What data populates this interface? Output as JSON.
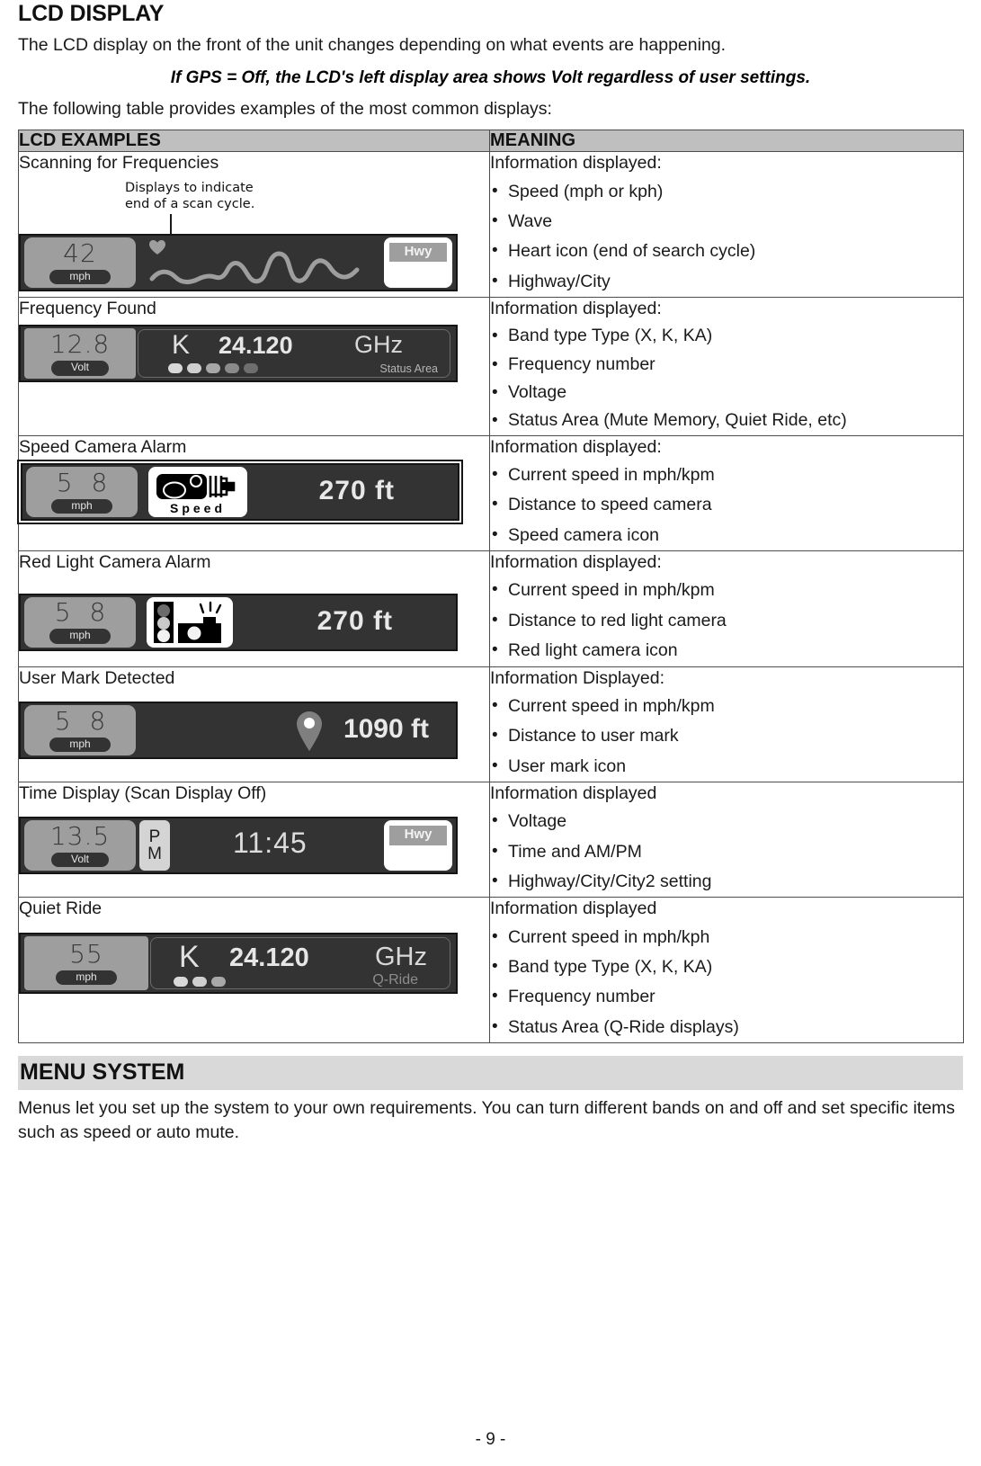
{
  "page": {
    "section_heading": "LCD DISPLAY",
    "intro_paragraph": "The LCD display on the front of the unit changes depending on what events are happening.",
    "note": "If GPS = Off, the LCD's left display area shows Volt regardless of user settings.",
    "lead_in": "The following table provides examples of the most common displays:",
    "footer": "- 9 -"
  },
  "table": {
    "headers": [
      "LCD EXAMPLES",
      "MEANING"
    ],
    "rows": [
      {
        "label": "Scanning for Frequencies",
        "callout": "Displays to indicate\nend of a scan cycle.",
        "callout_line1": "Displays to indicate",
        "callout_line2": "end of a scan cycle.",
        "lcd": {
          "left_value": "42",
          "left_unit": "mph",
          "hwy_label": "Hwy"
        },
        "meaning_head": "Information displayed:",
        "meaning_items": [
          "Speed (mph or kph)",
          "Wave",
          "Heart icon (end of search cycle)",
          "Highway/City"
        ]
      },
      {
        "label": "Frequency Found",
        "lcd": {
          "left_value": "12.8",
          "left_unit": "Volt",
          "band": "K",
          "freq_value": "24.120",
          "freq_unit": "GHz",
          "status_text": "Status Area",
          "dot_count": 5
        },
        "meaning_head": "Information displayed:",
        "meaning_items": [
          "Band type Type (X, K, KA)",
          "Frequency number",
          "Voltage",
          "Status Area (Mute Memory, Quiet Ride, etc)"
        ]
      },
      {
        "label": "Speed Camera Alarm",
        "lcd": {
          "left_value": "5 8",
          "left_unit": "mph",
          "icon_label": "Speed",
          "distance": "270  ft"
        },
        "meaning_head": "Information displayed:",
        "meaning_items": [
          "Current speed in mph/kpm",
          "Distance to speed camera",
          "Speed camera icon"
        ]
      },
      {
        "label": "Red Light Camera Alarm",
        "lcd": {
          "left_value": "5 8",
          "left_unit": "mph",
          "distance": "270  ft"
        },
        "meaning_head": "Information displayed:",
        "meaning_items": [
          "Current speed in mph/kpm",
          "Distance to red light camera",
          "Red light camera icon"
        ]
      },
      {
        "label": "User Mark Detected",
        "lcd": {
          "left_value": "5 8",
          "left_unit": "mph",
          "distance": "1090 ft"
        },
        "meaning_head": "Information Displayed:",
        "meaning_items": [
          "Current speed in mph/kpm",
          "Distance to user mark",
          "User mark icon"
        ]
      },
      {
        "label": "Time Display (Scan Display Off)",
        "lcd": {
          "left_value": "13.5",
          "left_unit": "Volt",
          "ampm_top": "P",
          "ampm_bottom": "M",
          "time": "11:45",
          "hwy_label": "Hwy"
        },
        "meaning_head": "Information displayed",
        "meaning_items": [
          "Voltage",
          "Time and AM/PM",
          "Highway/City/City2 setting"
        ]
      },
      {
        "label": "Quiet Ride",
        "lcd": {
          "left_value": "55",
          "left_unit": "mph",
          "band": "K",
          "freq_value": "24.120",
          "freq_unit": "GHz",
          "status_text": "Q-Ride",
          "dot_count": 3
        },
        "meaning_head": "Information displayed",
        "meaning_items": [
          "Current speed in mph/kph",
          "Band type Type (X, K, KA)",
          "Frequency number",
          "Status Area (Q-Ride displays)"
        ]
      }
    ]
  },
  "menu_section": {
    "title": "MENU SYSTEM",
    "paragraph": "Menus let you set up the system to your own requirements. You can turn different bands on and off and set specific items such as speed or auto mute."
  },
  "colors": {
    "header_fill": "#bfbfbf",
    "banner_fill": "#d9d9d9",
    "lcd_background": "#333333",
    "lcd_panel": "#9e9e9e",
    "lcd_text": "#e6e6e6"
  }
}
